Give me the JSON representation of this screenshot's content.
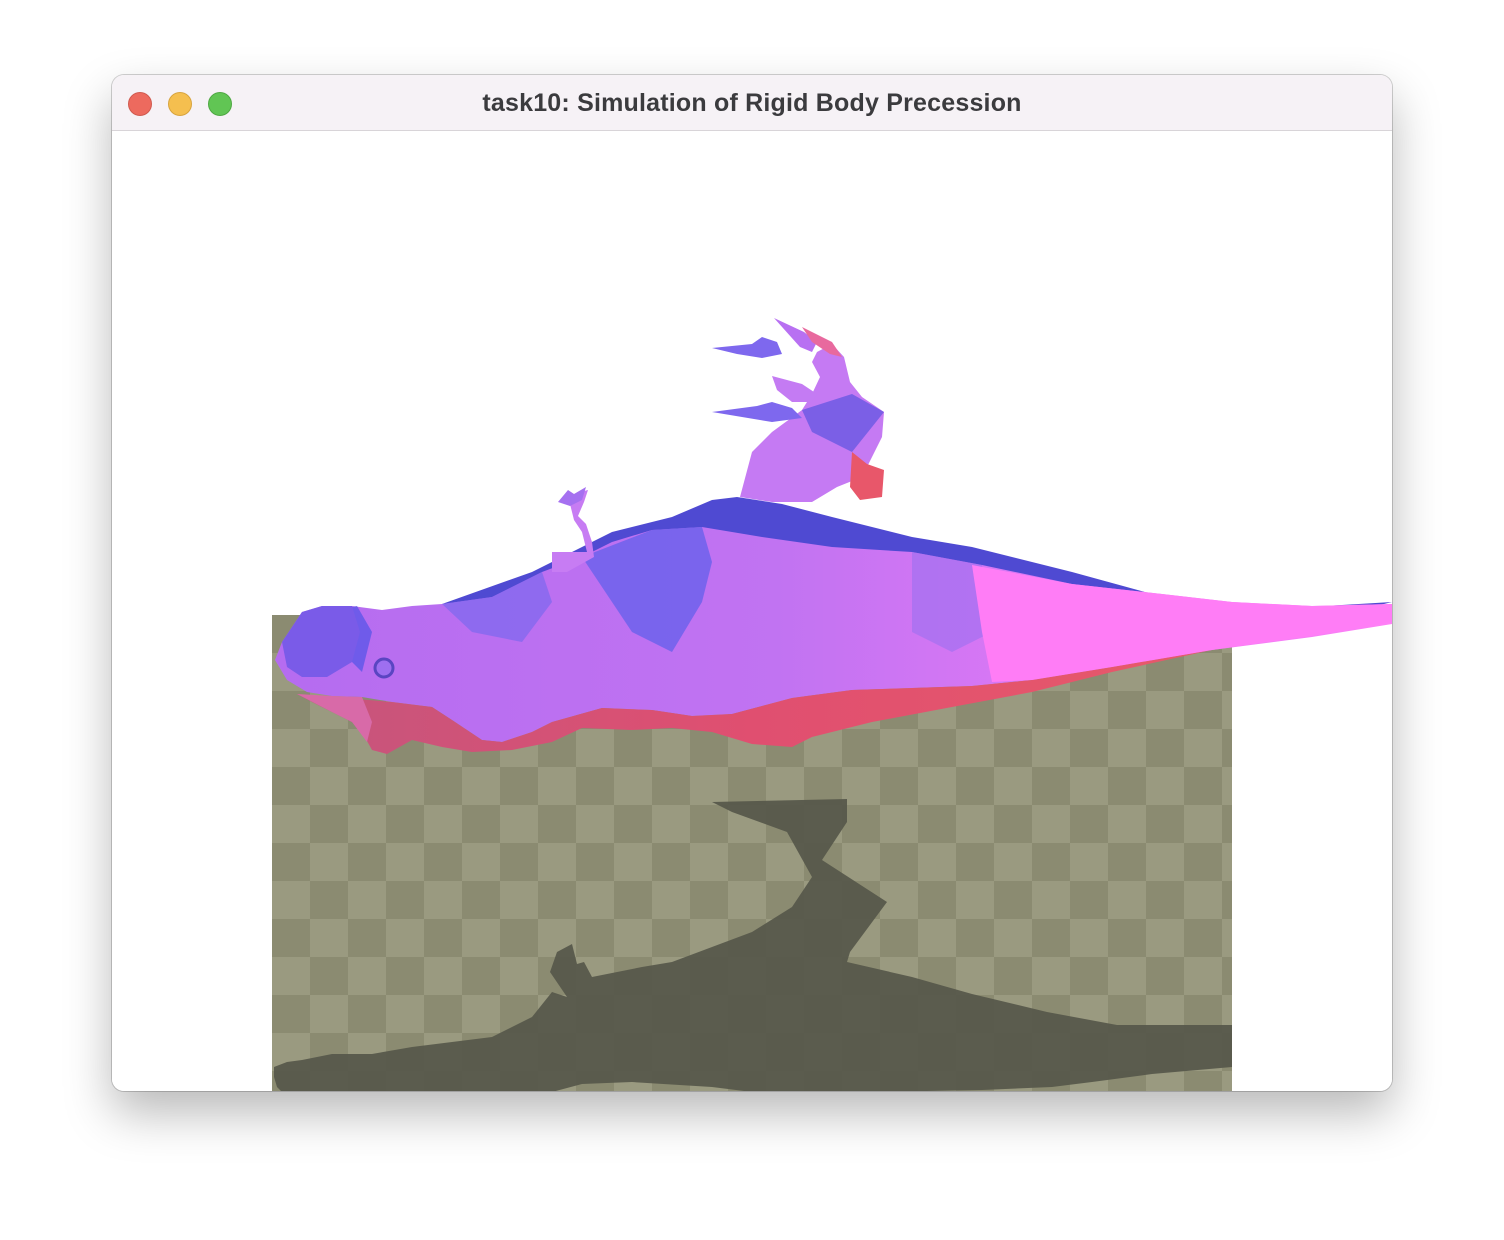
{
  "window": {
    "title": "task10: Simulation of Rigid Body Precession",
    "buttons": [
      "close",
      "minimize",
      "zoom"
    ]
  },
  "scene": {
    "ground": {
      "pattern": "checkerboard",
      "color_light": "#9a9a80",
      "color_dark": "#8a8a70"
    },
    "shadow_color": "#56574a",
    "model": "tyrannosaurus-mesh",
    "model_colors": {
      "top": "#5b54e6",
      "side": "#c877f4",
      "belly": "#e6566a",
      "tail": "#ff7df5"
    }
  }
}
